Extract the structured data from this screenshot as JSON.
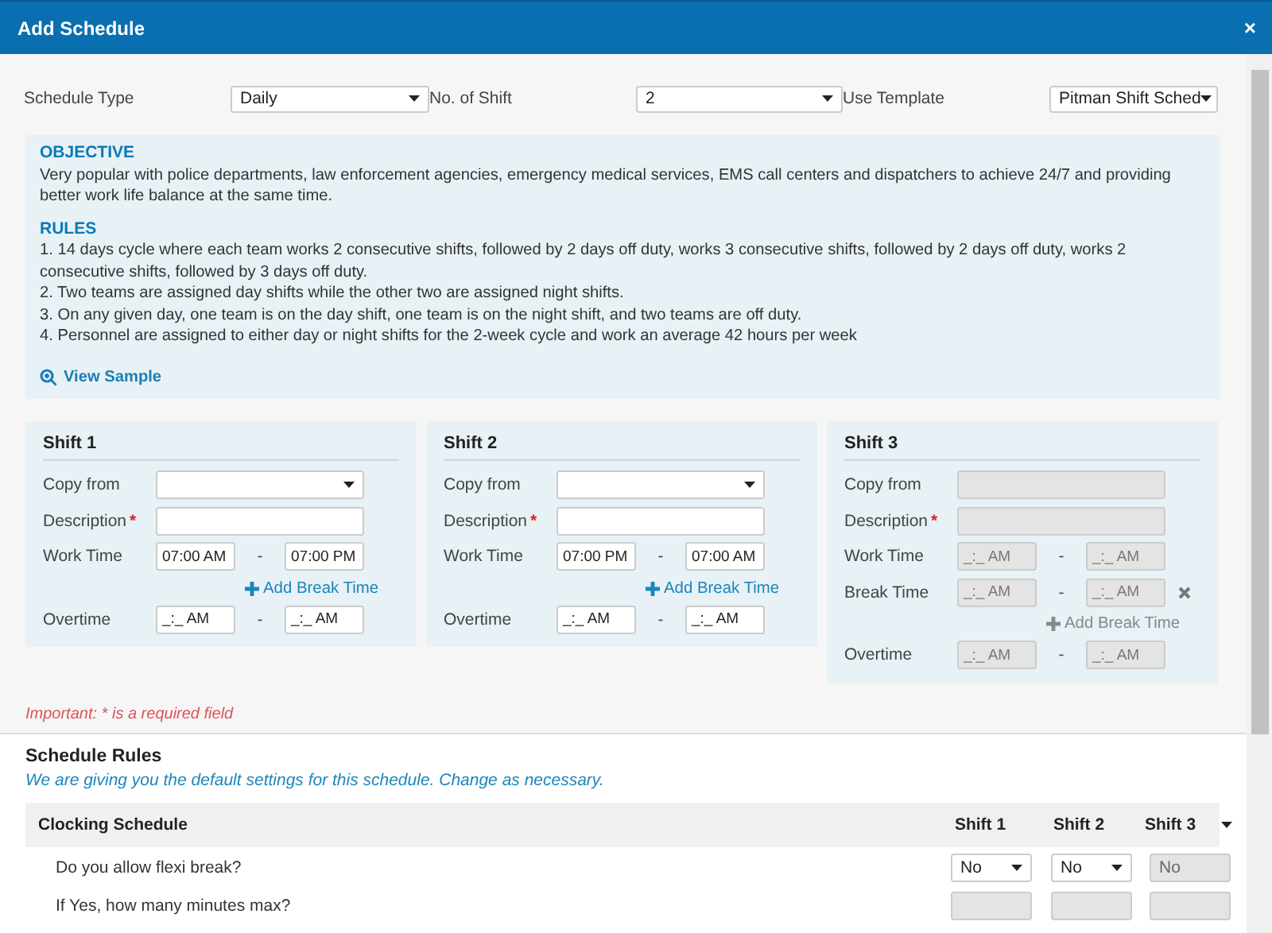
{
  "window": {
    "title": "Add Schedule",
    "close": "×"
  },
  "settings": [
    {
      "label": "Schedule Type",
      "value": "Daily"
    },
    {
      "label": "No. of Shift",
      "value": "2"
    },
    {
      "label": "Use Template",
      "value": "Pitman Shift Sched"
    }
  ],
  "info": {
    "objective_heading": "OBJECTIVE",
    "objective": "Very popular with police departments, law enforcement agencies, emergency medical services, EMS call centers and dispatchers to achieve 24/7 and providing better work life balance at the same time.",
    "rules_heading": "RULES",
    "rules": [
      "1. 14 days cycle where each team works 2 consecutive shifts, followed by 2 days off duty, works 3 consecutive shifts, followed by 2 days off duty, works 2 consecutive shifts, followed by 3 days off duty.",
      "2. Two teams are assigned day shifts while the other two are assigned night shifts.",
      "3. On any given day, one team is on the day shift, one team is on the night shift, and two teams are off duty.",
      "4. Personnel are assigned to either day or night shifts for the 2-week cycle and work an average 42 hours per week"
    ],
    "link": "View Sample"
  },
  "shifts": [
    {
      "title": "Shift 1",
      "disabled": false,
      "rows": [
        {
          "kind": "select",
          "label": "Copy from"
        },
        {
          "kind": "text",
          "label": "Description",
          "required_mark": "*"
        },
        {
          "kind": "range",
          "label": "Work Time",
          "start": "07:00 AM",
          "separator": "-",
          "end": "07:00 PM"
        },
        {
          "kind": "add",
          "label": "Add Break Time"
        },
        {
          "kind": "range",
          "label": "Overtime",
          "start": "_:_ AM",
          "separator": "-",
          "end": "_:_ AM"
        }
      ]
    },
    {
      "title": "Shift 2",
      "disabled": false,
      "rows": [
        {
          "kind": "select",
          "label": "Copy from"
        },
        {
          "kind": "text",
          "label": "Description",
          "required_mark": "*"
        },
        {
          "kind": "range",
          "label": "Work Time",
          "start": "07:00 PM",
          "separator": "-",
          "end": "07:00 AM"
        },
        {
          "kind": "add",
          "label": "Add Break Time"
        },
        {
          "kind": "range",
          "label": "Overtime",
          "start": "_:_ AM",
          "separator": "-",
          "end": "_:_ AM"
        }
      ]
    },
    {
      "title": "Shift 3",
      "disabled": true,
      "rows": [
        {
          "kind": "select",
          "label": "Copy from"
        },
        {
          "kind": "text",
          "label": "Description",
          "required_mark": "*"
        },
        {
          "kind": "range",
          "label": "Work Time",
          "start": "_:_ AM",
          "separator": "-",
          "end": "_:_ AM"
        },
        {
          "kind": "break",
          "label": "Break Time",
          "start": "_:_ AM",
          "separator": "-",
          "end": "_:_ AM"
        },
        {
          "kind": "add",
          "label": "Add Break Time"
        },
        {
          "kind": "range",
          "label": "Overtime",
          "start": "_:_ AM",
          "separator": "-",
          "end": "_:_ AM"
        }
      ]
    }
  ],
  "required_note": "Important: * is a required field",
  "schedule_rules": {
    "title": "Schedule Rules",
    "subtitle": "We are giving you the default settings for this schedule. Change as necessary.",
    "columns": [
      "Clocking Schedule",
      "Shift 1",
      "Shift 2",
      "Shift 3"
    ],
    "rows": [
      {
        "question": "Do you allow flexi break?",
        "values": [
          {
            "value": "No",
            "disabled": false
          },
          {
            "value": "No",
            "disabled": false
          },
          {
            "value": "No",
            "disabled": true
          }
        ]
      },
      {
        "question": "If Yes, how many minutes max?",
        "values": [
          {
            "disabled": true
          },
          {
            "disabled": true
          },
          {
            "disabled": true
          }
        ]
      }
    ]
  }
}
